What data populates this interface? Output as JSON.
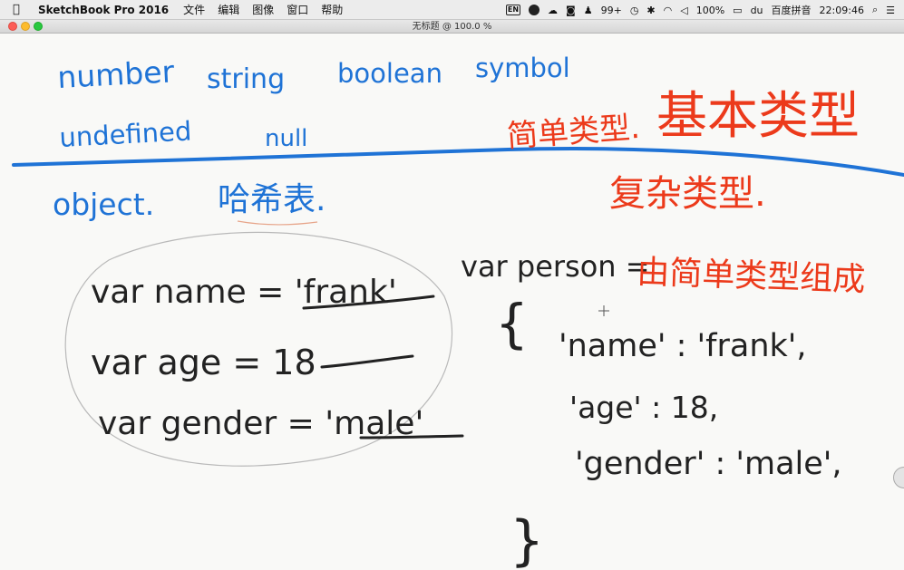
{
  "menubar": {
    "app_name": "SketchBook Pro 2016",
    "menus": [
      "文件",
      "编辑",
      "图像",
      "窗口",
      "帮助"
    ],
    "status": {
      "input_badge": "EN",
      "notifications": "99+",
      "battery": "100%",
      "ime": "百度拼音",
      "time": "22:09:46"
    }
  },
  "window": {
    "title": "无标题 @ 100.0 %"
  },
  "canvas": {
    "row1": [
      "number",
      "string",
      "boolean",
      "symbol"
    ],
    "row2": [
      "undefined",
      "null"
    ],
    "simple_types": "简单类型.",
    "basic_types": "基本类型",
    "object_label": "object.",
    "hash_table": "哈希表.",
    "complex_types": "复杂类型.",
    "code_lines": [
      "var  name = 'frank'",
      "var  age = 18",
      "var  gender = 'male'"
    ],
    "person_decl": "var person =",
    "composed_of": "由简单类型组成",
    "obj_open": "{",
    "obj_lines": [
      "'name' : 'frank',",
      "'age' : 18,",
      "'gender' : 'male',"
    ],
    "obj_close": "}"
  },
  "colors": {
    "blue_ink": "#1f73d6",
    "red_ink": "#ec3a1b",
    "black_ink": "#222222",
    "canvas_bg": "#f9f9f7"
  }
}
